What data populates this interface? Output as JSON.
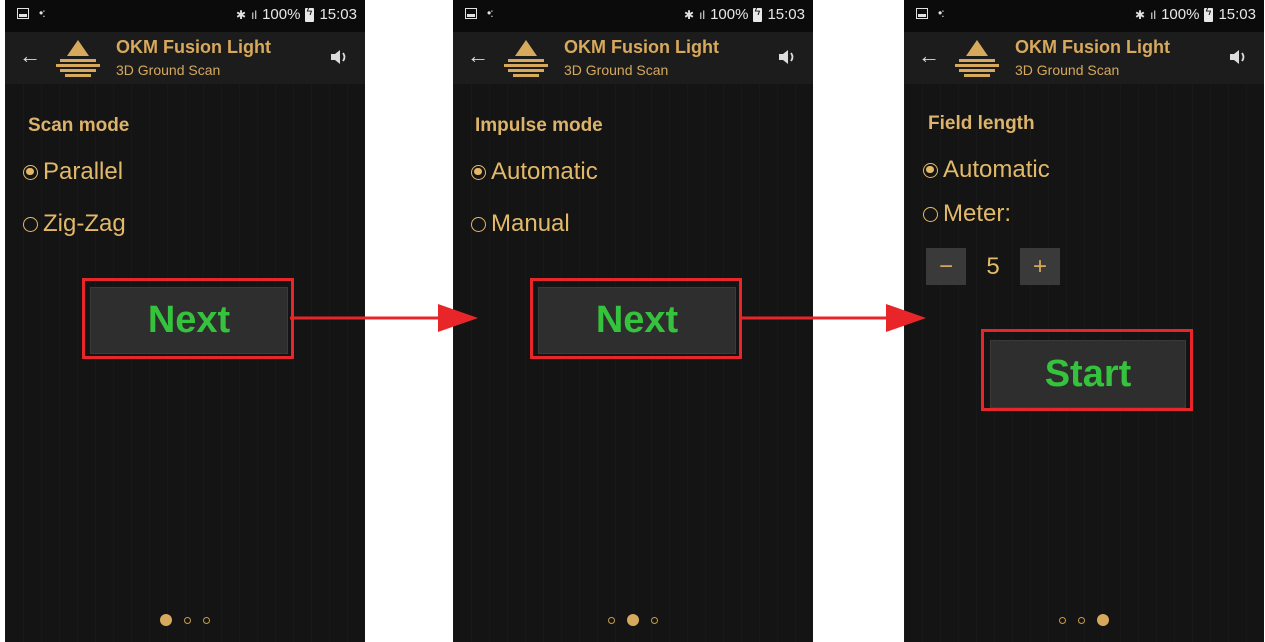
{
  "status_bar": {
    "signal": "ıl",
    "battery": "100%",
    "time": "15:03",
    "bluetooth": "✱"
  },
  "app_bar": {
    "title": "OKM Fusion Light",
    "subtitle": "3D Ground Scan",
    "back_icon": "arrow-left-icon",
    "sound_icon": "speaker-icon"
  },
  "screens": [
    {
      "heading": "Scan mode",
      "options": [
        {
          "label": "Parallel",
          "checked": true
        },
        {
          "label": "Zig-Zag",
          "checked": false
        }
      ],
      "button_label": "Next",
      "page_index": 0
    },
    {
      "heading": "Impulse mode",
      "options": [
        {
          "label": "Automatic",
          "checked": true
        },
        {
          "label": "Manual",
          "checked": false
        }
      ],
      "button_label": "Next",
      "page_index": 1
    },
    {
      "heading": "Field length",
      "options": [
        {
          "label": "Automatic",
          "checked": true
        },
        {
          "label": "Meter:",
          "checked": false
        }
      ],
      "stepper": {
        "minus": "−",
        "value": "5",
        "plus": "+"
      },
      "button_label": "Start",
      "page_index": 2
    }
  ],
  "colors": {
    "accent": "#d6a95c",
    "button_text": "#35c23c",
    "highlight": "#e8262a"
  }
}
